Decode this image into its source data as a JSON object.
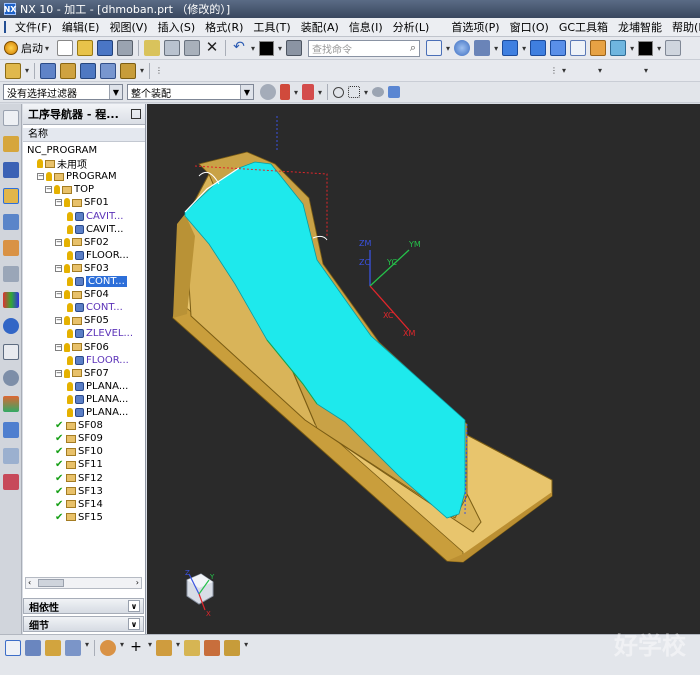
{
  "window": {
    "title": "NX 10 - 加工 - [dhmoban.prt  （修改的）]",
    "logo": "NX"
  },
  "menu": {
    "items": [
      "文件(F)",
      "编辑(E)",
      "视图(V)",
      "插入(S)",
      "格式(R)",
      "工具(T)",
      "装配(A)",
      "信息(I)",
      "分析(L)",
      "首选项(P)",
      "窗口(O)",
      "GC工具箱",
      "龙埔智能",
      "帮助(H)"
    ]
  },
  "toolbar": {
    "start_label": "启动",
    "search_placeholder": "查找命令"
  },
  "selection_bar": {
    "filter_value": "没有选择过滤器",
    "assembly_value": "整个装配"
  },
  "navigator": {
    "title": "工序导航器 - 程...",
    "column_header": "名称",
    "tree": [
      {
        "label": "NC_PROGRAM",
        "level": 0,
        "type": "root"
      },
      {
        "label": "未用项",
        "level": 1,
        "type": "folder"
      },
      {
        "label": "PROGRAM",
        "level": 1,
        "type": "program",
        "exp": "−"
      },
      {
        "label": "TOP",
        "level": 2,
        "type": "program",
        "exp": "−"
      },
      {
        "label": "SF01",
        "level": 3,
        "type": "program",
        "exp": "−"
      },
      {
        "label": "CAVIT...",
        "level": 4,
        "type": "op",
        "style": "purple"
      },
      {
        "label": "CAVIT...",
        "level": 4,
        "type": "op"
      },
      {
        "label": "SF02",
        "level": 3,
        "type": "program",
        "exp": "−"
      },
      {
        "label": "FLOOR...",
        "level": 4,
        "type": "op"
      },
      {
        "label": "SF03",
        "level": 3,
        "type": "program",
        "exp": "−"
      },
      {
        "label": "CONT...",
        "level": 4,
        "type": "op",
        "style": "hl"
      },
      {
        "label": "SF04",
        "level": 3,
        "type": "program",
        "exp": "−"
      },
      {
        "label": "CONT...",
        "level": 4,
        "type": "op",
        "style": "purple"
      },
      {
        "label": "SF05",
        "level": 3,
        "type": "program",
        "exp": "−"
      },
      {
        "label": "ZLEVEL...",
        "level": 4,
        "type": "op",
        "style": "purple"
      },
      {
        "label": "SF06",
        "level": 3,
        "type": "program",
        "exp": "−"
      },
      {
        "label": "FLOOR...",
        "level": 4,
        "type": "op",
        "style": "purple"
      },
      {
        "label": "SF07",
        "level": 3,
        "type": "program",
        "exp": "−"
      },
      {
        "label": "PLANA...",
        "level": 4,
        "type": "op"
      },
      {
        "label": "PLANA...",
        "level": 4,
        "type": "op"
      },
      {
        "label": "PLANA...",
        "level": 4,
        "type": "op"
      },
      {
        "label": "SF08",
        "level": 3,
        "type": "done"
      },
      {
        "label": "SF09",
        "level": 3,
        "type": "done"
      },
      {
        "label": "SF10",
        "level": 3,
        "type": "done"
      },
      {
        "label": "SF11",
        "level": 3,
        "type": "done"
      },
      {
        "label": "SF12",
        "level": 3,
        "type": "done"
      },
      {
        "label": "SF13",
        "level": 3,
        "type": "done"
      },
      {
        "label": "SF14",
        "level": 3,
        "type": "done"
      },
      {
        "label": "SF15",
        "level": 3,
        "type": "done"
      }
    ],
    "panels": {
      "dependencies": "相依性",
      "details": "细节"
    }
  },
  "viewport": {
    "axes_labels": {
      "zm": "ZM",
      "zc": "ZC",
      "ym": "YM",
      "yc": "YC",
      "xc": "XC",
      "xm": "XM"
    },
    "triad_labels": {
      "z": "Z",
      "y": "Y",
      "x": "X"
    },
    "colors": {
      "background": "#2a2a2a",
      "base": "#e5c16a",
      "surface": "#1ee9ec",
      "axis_z": "#3a52e0",
      "axis_y": "#25c14a",
      "axis_x": "#e0262b"
    }
  },
  "watermark": "好学校"
}
